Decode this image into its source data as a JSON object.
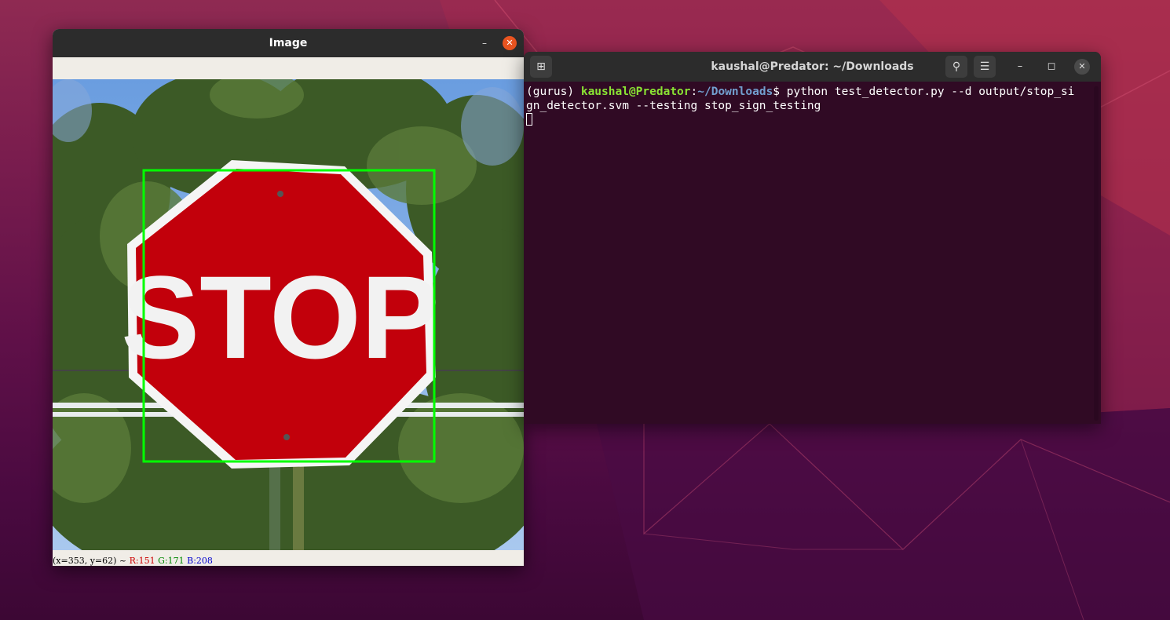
{
  "colors": {
    "accent": "#e95420",
    "terminal_bg": "#300a24",
    "prompt_user": "#8ae234",
    "prompt_path": "#729fcf",
    "detection_box": "#00ff00"
  },
  "image_window": {
    "title": "Image",
    "min_icon": "minimize-icon",
    "close_icon": "close-icon",
    "photo_text": "STOP",
    "status": {
      "coords": "(x=353, y=62) ~",
      "r": "R:151",
      "g": "G:171",
      "b": "B:208"
    }
  },
  "terminal": {
    "title": "kaushal@Predator: ~/Downloads",
    "new_tab_icon": "new-tab-icon",
    "search_icon": "search-icon",
    "menu_icon": "hamburger-menu-icon",
    "env": "(gurus) ",
    "user_host": "kaushal@Predator",
    "colon": ":",
    "path": "~/Downloads",
    "prompt_symbol": "$ ",
    "command_line1": "python test_detector.py --d output/stop_si",
    "command_line2": "gn_detector.svm --testing stop_sign_testing"
  }
}
